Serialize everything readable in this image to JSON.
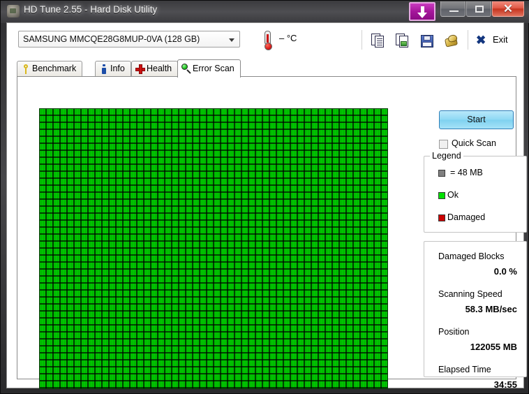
{
  "window": {
    "title": "HD Tune 2.55 - Hard Disk Utility",
    "app_icon": "hdtune-icon",
    "controls": {
      "download_badge": "download-update-badge",
      "minimize": "–",
      "maximize": "□",
      "close": "✕"
    }
  },
  "toolbar": {
    "drive_selected": "SAMSUNG MMCQE28G8MUP-0VA (128 GB)",
    "temperature": "– °C",
    "icons": [
      {
        "name": "copy-icon",
        "title": "Copy"
      },
      {
        "name": "copy-image-icon",
        "title": "Copy screenshot"
      },
      {
        "name": "save-icon",
        "title": "Save"
      },
      {
        "name": "gold-disc-icon",
        "title": "Info"
      }
    ],
    "exit_label": "Exit"
  },
  "tabs": [
    {
      "label": "Benchmark",
      "icon": "key-icon",
      "active": false
    },
    {
      "label": "Info",
      "icon": "info-icon",
      "active": false
    },
    {
      "label": "Health",
      "icon": "red-cross-icon",
      "active": false
    },
    {
      "label": "Error Scan",
      "icon": "magnifier-icon",
      "active": true
    }
  ],
  "error_scan": {
    "start_button": "Start",
    "quick_scan_label": "Quick Scan",
    "quick_scan_checked": false,
    "legend": {
      "title": "Legend",
      "rows": [
        {
          "swatch": "#808080",
          "text": "= 48 MB"
        },
        {
          "swatch": "#00e000",
          "text": "Ok"
        },
        {
          "swatch": "#cc0000",
          "text": "Damaged"
        }
      ]
    },
    "stats": [
      {
        "label": "Damaged Blocks",
        "value": "0.0 %"
      },
      {
        "label": "Scanning Speed",
        "value": "58.3 MB/sec"
      },
      {
        "label": "Position",
        "value": "122055 MB"
      },
      {
        "label": "Elapsed Time",
        "value": "34:55"
      }
    ],
    "blockmap": {
      "columns": 50,
      "rows": 40,
      "cell_block_size": "48 MB",
      "ok_color": "#00e000",
      "damaged_color": "#cc0000",
      "grid_color": "#0a4d0a",
      "all_ok": true
    }
  },
  "colors": {
    "accent": "#8fd9f4",
    "ok": "#00e000",
    "damaged": "#cc0000",
    "unscanned": "#808080",
    "title_badge": "#a5169b"
  }
}
